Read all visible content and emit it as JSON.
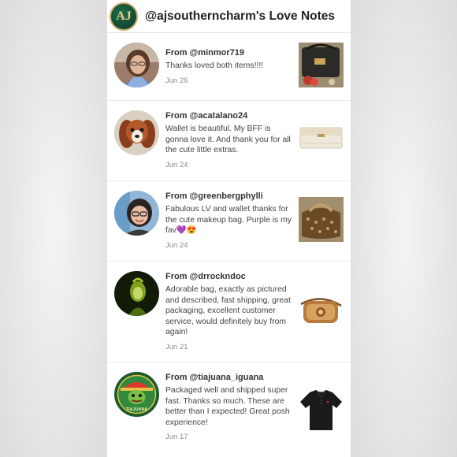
{
  "header": {
    "logo_text": "AJ",
    "title": "@ajsoutherncharm's Love Notes"
  },
  "notes": [
    {
      "from": "From @minmor719",
      "message": "Thanks loved both items!!!!",
      "date": "Jun 26",
      "avatar": "woman-with-glasses-avatar",
      "thumbnail": "black-handbag-with-red-flowers"
    },
    {
      "from": "From @acatalano24",
      "message": "Wallet is beautiful. My BFF is gonna love it. And thank you for all the cute little extras.",
      "date": "Jun 24",
      "avatar": "cavalier-spaniel-dog-avatar",
      "thumbnail": "cream-wallet"
    },
    {
      "from": "From @greenbergphylli",
      "message": "Fabulous LV and wallet thanks for the cute makeup bag. Purple is my fav💜😍",
      "date": "Jun 24",
      "avatar": "woman-smiling-avatar",
      "thumbnail": "lv-duffel-bag"
    },
    {
      "from": "From @drrockndoc",
      "message": "Adorable bag, exactly as pictured and described, fast shipping, great packaging, excellent customer service, would definitely buy from again!",
      "date": "Jun 21",
      "avatar": "dark-green-silhouette-avatar",
      "thumbnail": "tan-crossbody-bag"
    },
    {
      "from": "From @tiajuana_iguana",
      "message": "Packaged well and shipped super fast. Thanks so much. These are better than I expected! Great posh experience!",
      "date": "Jun 17",
      "avatar": "tiajuana-iguana-logo-avatar",
      "avatar_text": "TIAJUANA",
      "thumbnail": "black-polo-shirt"
    }
  ]
}
